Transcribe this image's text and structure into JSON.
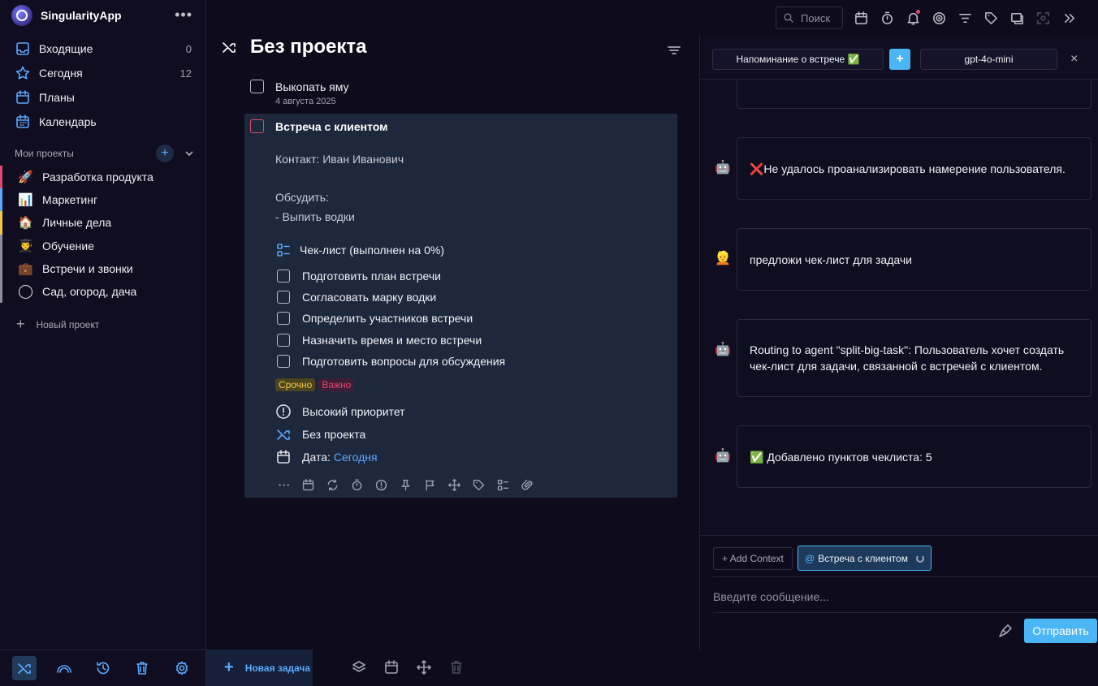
{
  "app": {
    "name": "SingularityApp",
    "more": "•••"
  },
  "nav": [
    {
      "label": "Входящие",
      "count": "0"
    },
    {
      "label": "Сегодня",
      "count": "12"
    },
    {
      "label": "Планы",
      "count": ""
    },
    {
      "label": "Календарь",
      "count": ""
    }
  ],
  "projects": {
    "header": "Мои проекты",
    "plus": "+",
    "items": [
      {
        "emoji": "🚀",
        "label": "Разработка продукта",
        "color": "#e0486e"
      },
      {
        "emoji": "📊",
        "label": "Маркетинг",
        "color": "#5aa9ff"
      },
      {
        "emoji": "🏠",
        "label": "Личные дела",
        "color": "#f2c744"
      },
      {
        "emoji": "👨‍🎓",
        "label": "Обучение",
        "color": "#8d8fa0"
      },
      {
        "emoji": "💼",
        "label": "Встречи и звонки",
        "color": "#8d8fa0"
      },
      {
        "emoji": "◯",
        "label": "Сад, огород, дача",
        "color": "#8d8fa0"
      }
    ],
    "new_label": "Новый проект",
    "new_plus": "+"
  },
  "main": {
    "title": "Без проекта",
    "task1": {
      "title": "Выкопать яму",
      "date": "4 августа 2025"
    },
    "task2": {
      "title": "Встреча с клиентом",
      "desc": [
        "Контакт: Иван Иванович",
        "Обсудить:",
        "- Выпить водки"
      ],
      "checklist_title": "Чек-лист (выполнен на 0%)",
      "checklist": [
        "Подготовить план встречи",
        "Согласовать марку водки",
        "Определить участников встречи",
        "Назначить время и место встречи",
        "Подготовить вопросы для обсуждения"
      ],
      "tags": [
        "Срочно",
        "Важно"
      ],
      "priority": "Высокий приоритет",
      "project": "Без проекта",
      "date_label": "Дата:",
      "date_value": "Сегодня"
    },
    "new_task": "Новая задача",
    "new_task_plus": "+"
  },
  "search": {
    "placeholder": "Поиск"
  },
  "ai": {
    "tabs": {
      "chat": "Напоминание о встрече ✅",
      "plus": "+",
      "model": "gpt-4o-mini"
    },
    "close": "×",
    "messages": [
      {
        "role": "bot",
        "avatar": "🤖",
        "text": "❌Не удалось проанализировать намерение пользователя."
      },
      {
        "role": "user",
        "avatar": "👱",
        "text": "предложи чек-лист для задачи"
      },
      {
        "role": "bot",
        "avatar": "🤖",
        "text": "Routing to agent \"split-big-task\": Пользователь хочет создать чек-лист для задачи, связанной с встречей с клиентом."
      },
      {
        "role": "bot",
        "avatar": "🤖",
        "text": "✅ Добавлено пунктов чеклиста: 5"
      }
    ],
    "add_context": "+ Add Context",
    "context_at": "@",
    "context_chip": "Встреча с клиентом",
    "input_placeholder": "Введите сообщение...",
    "send": "Отправить"
  },
  "colors": {
    "accent": "#4bb6f5",
    "card": "#1d283d",
    "urgent": "#f2c744",
    "important": "#e0486e"
  }
}
